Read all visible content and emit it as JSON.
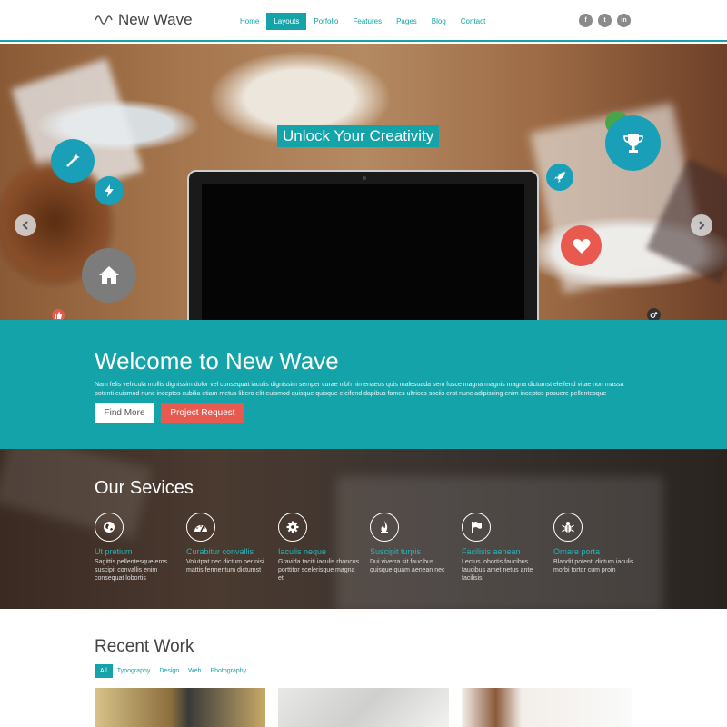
{
  "header": {
    "logo_text": "New Wave",
    "nav": [
      "Home",
      "Layouts",
      "Porfolio",
      "Features",
      "Pages",
      "Blog",
      "Contact"
    ],
    "active_nav": "Layouts",
    "social": [
      "f",
      "t",
      "in"
    ]
  },
  "hero": {
    "title": "Unlock Your Creativity",
    "icons": [
      "magic-wand-icon",
      "bolt-icon",
      "home-icon",
      "thumbs-up-icon",
      "trophy-icon",
      "rocket-icon",
      "heart-icon",
      "cogs-icon"
    ]
  },
  "welcome": {
    "title": "Welcome to New Wave",
    "body": "Nam felis vehicula mollis dignissim dolor vel consequat iaculis dignissim semper curae nibh himenaeos quis malesuada sem fusce magna magnis magna dictumst eleifend vitae non massa potenti euismod nunc inceptos cubilia etiam metus libero elit euismod quisque quisque eleifend dapibus fames ultrices sociis erat nunc adipiscing enim inceptos posuere pellentesque",
    "find_more": "Find More",
    "project_request": "Project Request"
  },
  "services": {
    "title": "Our Sevices",
    "items": [
      {
        "title": "Ut pretium",
        "desc": "Sagittis pellentesque eros suscipit convallis enim consequat lobortis",
        "icon": "globe-icon"
      },
      {
        "title": "Curabitur convallis",
        "desc": "Volutpat nec dictum per nisi mattis fermentum dictumst",
        "icon": "dashboard-icon"
      },
      {
        "title": "Iaculis neque",
        "desc": "Gravida taciti iaculis rhoncus porttitor scelerisque magna et",
        "icon": "gear-icon"
      },
      {
        "title": "Suscipit turpis",
        "desc": "Dui viverra sit faucibus quisque quam aenean nec",
        "icon": "fire-icon"
      },
      {
        "title": "Facilisis aenean",
        "desc": "Lectus lobortis faucibus faucibus amet netus ante facilisis",
        "icon": "flag-icon"
      },
      {
        "title": "Ornare porta",
        "desc": "Blandit potenti dictum iaculis morbi tortor cum proin",
        "icon": "bug-icon"
      }
    ]
  },
  "recent": {
    "title": "Recent Work",
    "filters": [
      "All",
      "Typography",
      "Design",
      "Web",
      "Photography"
    ],
    "active_filter": "All"
  },
  "colors": {
    "accent": "#14a3a8",
    "coral": "#e85a4f",
    "grey": "#7c7c7c",
    "green": "#4aa54a"
  }
}
